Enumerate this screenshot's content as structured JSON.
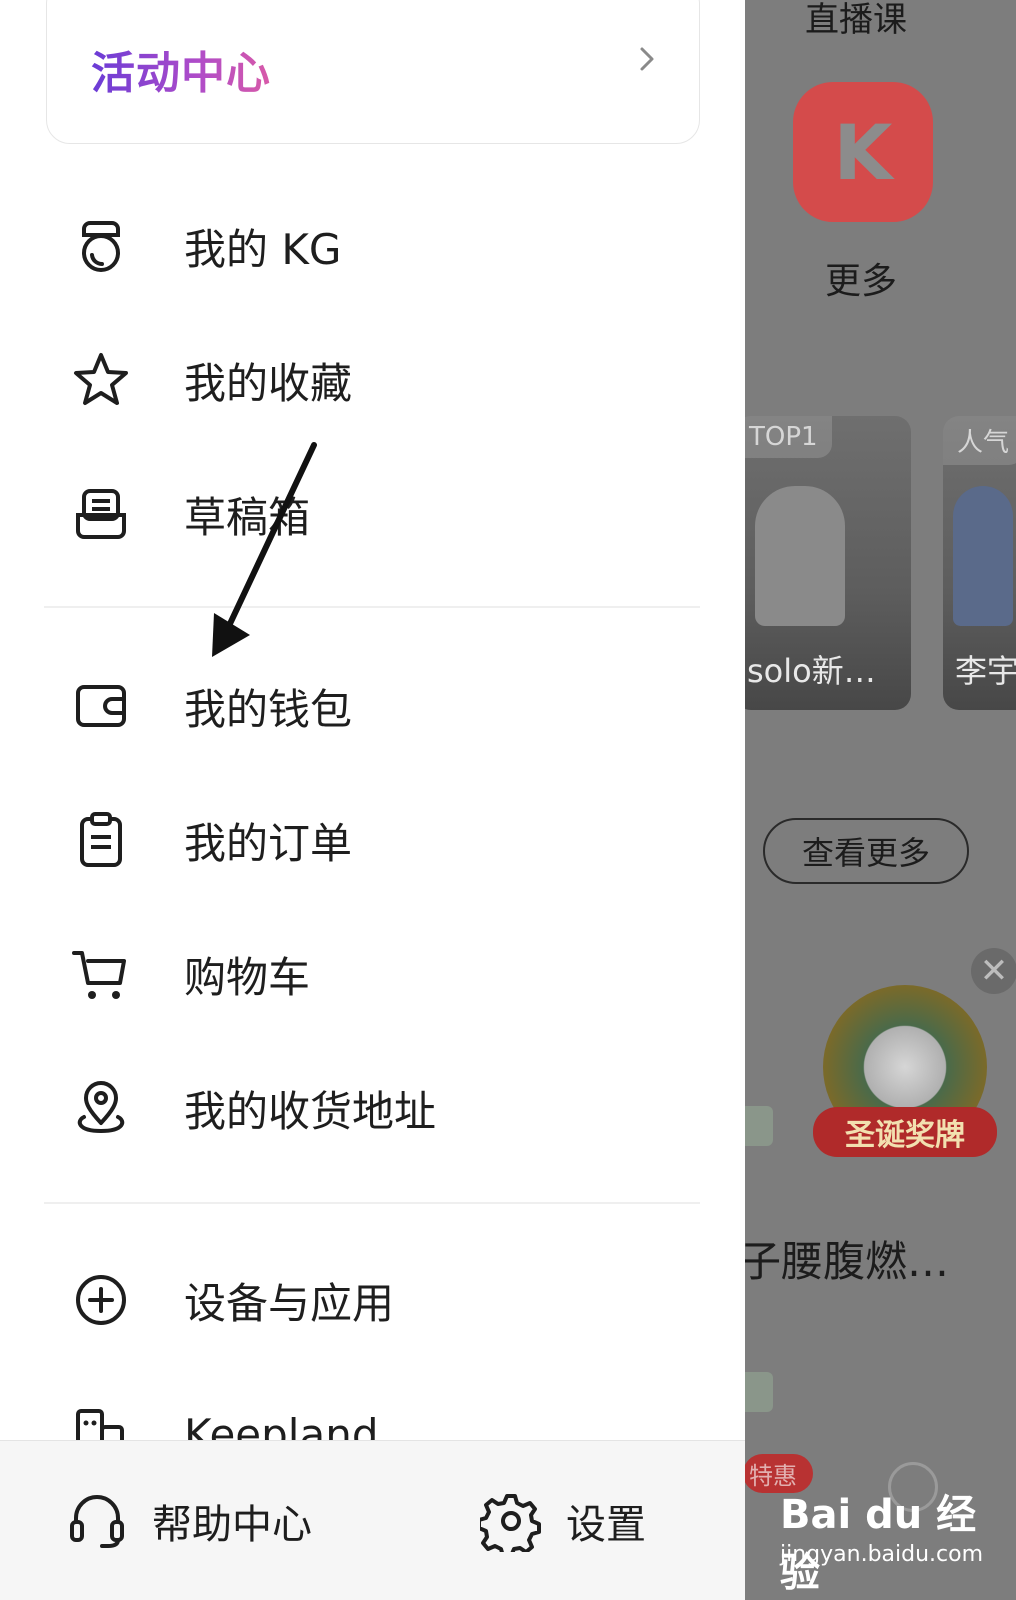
{
  "background_app": {
    "live_course_title": "直播课",
    "more_tile_letter": "K",
    "more_label": "更多",
    "cards": [
      {
        "badge": "TOP1",
        "caption": "solo新…"
      },
      {
        "badge": "人气",
        "caption": "李宇"
      }
    ],
    "see_more_button": "查看更多",
    "close_symbol": "✕",
    "medal_text": "圣诞奖牌",
    "course_title": "子腰腹燃…",
    "promo_tag": "特惠",
    "accent_color": "#d44b4b"
  },
  "drawer": {
    "activity_center": {
      "title": "活动中心"
    },
    "menu_group_1": [
      {
        "label": "我的 KG",
        "icon": "kettlebell-icon"
      },
      {
        "label": "我的收藏",
        "icon": "star-icon"
      },
      {
        "label": "草稿箱",
        "icon": "drafts-box-icon"
      }
    ],
    "menu_group_2": [
      {
        "label": "我的钱包",
        "icon": "wallet-icon"
      },
      {
        "label": "我的订单",
        "icon": "clipboard-icon"
      },
      {
        "label": "购物车",
        "icon": "cart-icon"
      },
      {
        "label": "我的收货地址",
        "icon": "location-pin-icon"
      }
    ],
    "menu_group_3": [
      {
        "label": "设备与应用",
        "icon": "plus-circle-icon"
      },
      {
        "label": "Keepland",
        "icon": "building-icon"
      }
    ],
    "bottom_bar": {
      "help_center": "帮助中心",
      "settings": "设置"
    }
  },
  "watermark": {
    "brand": "Bai du 经验",
    "url": "jingyan.baidu.com"
  }
}
